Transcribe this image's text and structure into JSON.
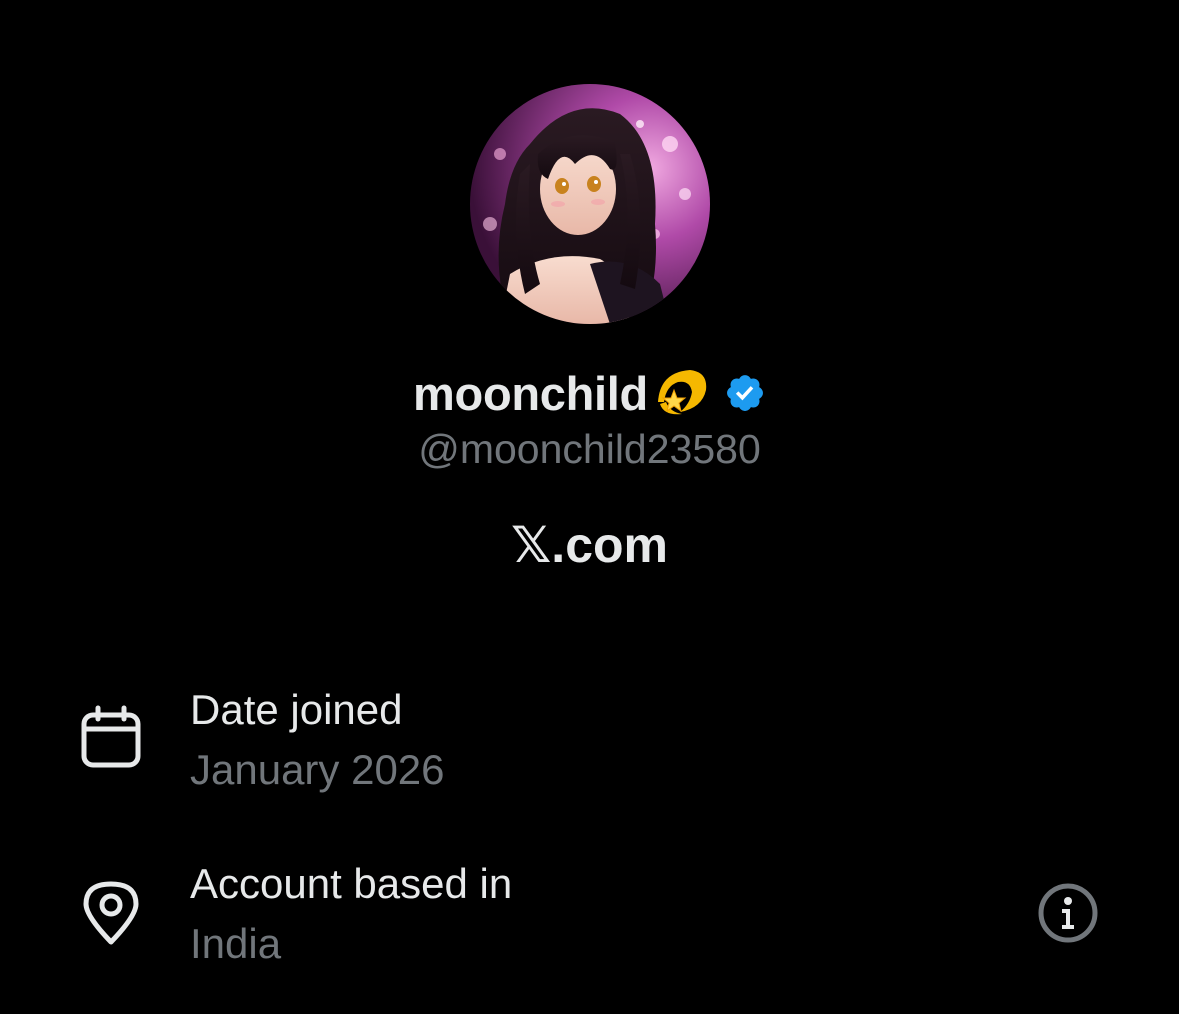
{
  "profile": {
    "display_name": "moonchild",
    "handle": "@moonchild23580",
    "site": "X.com",
    "site_mark": "𝕏",
    "site_suffix": ".com"
  },
  "details": {
    "joined": {
      "title": "Date joined",
      "value": "January 2026",
      "icon": "calendar-icon"
    },
    "location": {
      "title": "Account based in",
      "value": "India",
      "icon": "location-pin-icon"
    }
  },
  "icons": {
    "verified": "verified-badge-icon",
    "emoji": "dizzy-star-emoji",
    "info": "info-icon"
  },
  "colors": {
    "background": "#000000",
    "primary_text": "#e7e9ea",
    "secondary_text": "#71767b",
    "verified_blue": "#1d9bf0"
  }
}
